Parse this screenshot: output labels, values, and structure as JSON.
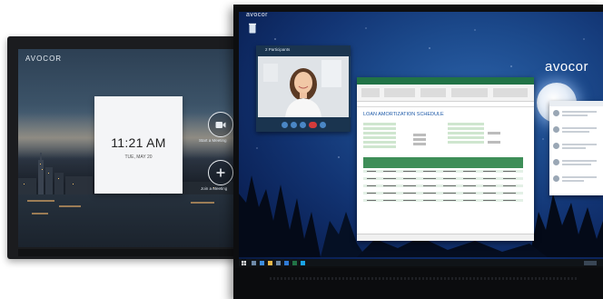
{
  "left_display": {
    "brand": "AVOCOR",
    "lock_screen": {
      "time": "11:21 AM",
      "date": "TUE, MAY 20"
    },
    "actions": [
      {
        "label": "Start a Meeting",
        "icon": "video-camera-icon"
      },
      {
        "label": "Join a Meeting",
        "icon": "plus-icon"
      }
    ]
  },
  "right_display": {
    "top_brand": "avocor",
    "wallpaper_brand": "avocor",
    "video_call": {
      "title": "2 Participants"
    },
    "spreadsheet": {
      "sheet_title": "LOAN AMORTIZATION SCHEDULE",
      "accent_color": "#217346"
    },
    "taskbar_icons": [
      "start-icon",
      "task-view-icon",
      "edge-icon",
      "explorer-icon",
      "store-icon",
      "mail-icon",
      "excel-icon",
      "skype-icon"
    ]
  },
  "colors": {
    "wallpaper": "#123473",
    "excel_green": "#217346",
    "table_header": "#3e8e58"
  }
}
